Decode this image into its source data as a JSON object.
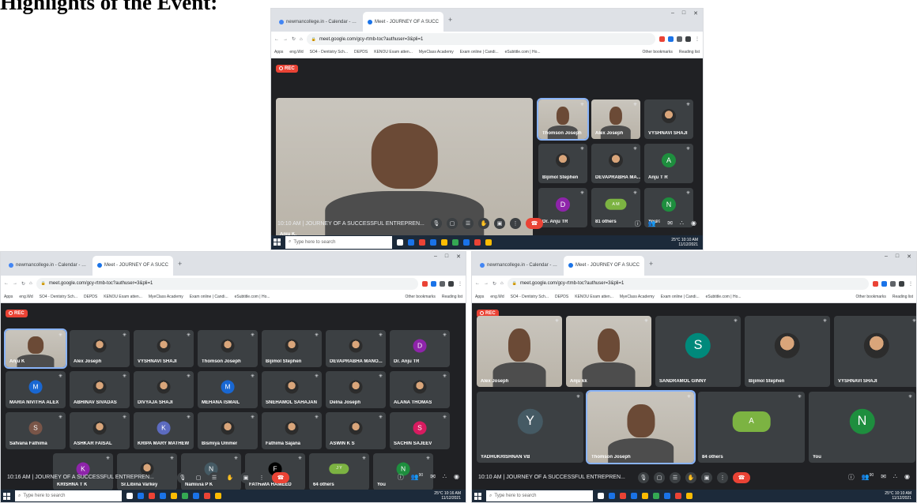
{
  "heading": "Highlights of the Event:",
  "browser": {
    "tabs": [
      "newmancollege.in - Calendar - …",
      "Meet - JOURNEY OF A SUCC"
    ],
    "new_tab": "+",
    "url": "meet.google.com/gcy-rtmb-toc?authuser=3&pli=1",
    "bookmarks": [
      "Apps",
      "eng.Wd",
      "SO4 - Dentistry Sch...",
      "DEPDS",
      "KENOU Exam atten...",
      "MyeClass Academy",
      "Exam online | Candi...",
      "eSubtitle.com | Ho..."
    ],
    "bookmarks_right": [
      "Other bookmarks",
      "Reading list"
    ]
  },
  "meeting": {
    "rec": "REC",
    "title": "JOURNEY OF A SUCCESSFUL ENTREPREN...",
    "end_call_icon": "phone-hangup-icon"
  },
  "taskbar": {
    "search_placeholder": "Type here to search",
    "date": "11/12/2021",
    "weather": "25°C"
  },
  "screens": {
    "top": {
      "time": "10:10 AM",
      "clock": "10:10 AM",
      "main_speaker": "Anju K.",
      "tiles": [
        {
          "name": "Thomson Joseph",
          "type": "video",
          "pinned": true
        },
        {
          "name": "Alex Joseph",
          "type": "video"
        },
        {
          "name": "VYSHNAVI SHAJI",
          "type": "photo"
        },
        {
          "name": "Bijimol Stephen",
          "type": "photo"
        },
        {
          "name": "DEVAPRABHA MA...",
          "type": "photo"
        },
        {
          "name": "Anju T R",
          "type": "letter",
          "letter": "A",
          "color": "#1e8e3e"
        },
        {
          "name": "Dr. Anju TR",
          "type": "letter",
          "letter": "D",
          "color": "#8e24aa"
        },
        {
          "name": "81 others",
          "type": "others",
          "letters": "A M"
        },
        {
          "name": "You",
          "type": "letter",
          "letter": "N",
          "color": "#1e8e3e"
        }
      ],
      "participant_count": "96"
    },
    "left": {
      "time": "10:16 AM",
      "clock": "10:16 AM",
      "participant_count": "90",
      "tiles": [
        {
          "name": "Anju K",
          "type": "video",
          "pinned": true
        },
        {
          "name": "Alex Joseph",
          "type": "photo"
        },
        {
          "name": "VYSHNAVI SHAJI",
          "type": "photo"
        },
        {
          "name": "Thomson Joseph",
          "type": "photo"
        },
        {
          "name": "Bijimol Stephen",
          "type": "photo"
        },
        {
          "name": "DEVAPRABHA MANO...",
          "type": "photo"
        },
        {
          "name": "Dr. Anju TR",
          "type": "letter",
          "letter": "D",
          "color": "#8e24aa"
        },
        {
          "name": "MARIA NIVITHA ALEX",
          "type": "letter",
          "letter": "M",
          "color": "#1967d2"
        },
        {
          "name": "ABHINAV SIVADAS",
          "type": "photo"
        },
        {
          "name": "DIVYAJA SHAJI",
          "type": "photo"
        },
        {
          "name": "MEHANA ISMAIL",
          "type": "letter",
          "letter": "M",
          "color": "#1967d2"
        },
        {
          "name": "SNEHAMOL SAHAJAN",
          "type": "photo"
        },
        {
          "name": "Delna Joseph",
          "type": "photo"
        },
        {
          "name": "ALANA THOMAS",
          "type": "photo"
        },
        {
          "name": "Safvana Fathima",
          "type": "letter",
          "letter": "S",
          "color": "#795548"
        },
        {
          "name": "ASHKAR FAISAL",
          "type": "photo"
        },
        {
          "name": "KRIPA MARY MATHEW",
          "type": "letter",
          "letter": "K",
          "color": "#5c6bc0"
        },
        {
          "name": "Bismiya Ummer",
          "type": "photo"
        },
        {
          "name": "Fathima Sajana",
          "type": "photo"
        },
        {
          "name": "ASWIN K S",
          "type": "photo"
        },
        {
          "name": "SACHIN SAJEEV",
          "type": "letter",
          "letter": "S",
          "color": "#d81b60"
        },
        {
          "name": "KRISHNA T K",
          "type": "letter",
          "letter": "K",
          "color": "#8e24aa"
        },
        {
          "name": "Sr.Libina Varkey",
          "type": "photo"
        },
        {
          "name": "Namitha P K",
          "type": "letter",
          "letter": "N",
          "color": "#455a64"
        },
        {
          "name": "FATHIMA HAMEED",
          "type": "letter",
          "letter": "F",
          "color": "#000000"
        },
        {
          "name": "64 others",
          "type": "others",
          "letters": "J Y"
        },
        {
          "name": "You",
          "type": "letter",
          "letter": "N",
          "color": "#1e8e3e"
        }
      ]
    },
    "right": {
      "time": "10:10 AM",
      "clock": "10:10 AM",
      "participant_count": "90",
      "tiles": [
        {
          "name": "Alex Joseph",
          "type": "video"
        },
        {
          "name": "Anju kk",
          "type": "video"
        },
        {
          "name": "SANDRAMOL GINNY",
          "type": "letter",
          "letter": "S",
          "color": "#00897b"
        },
        {
          "name": "Bijimol Stephen",
          "type": "photo"
        },
        {
          "name": "VYSHNAVI SHAJI",
          "type": "photo"
        },
        {
          "name": "YADHUKRISHNAN VB",
          "type": "letter",
          "letter": "Y",
          "color": "#455a64"
        },
        {
          "name": "Thomson Joseph",
          "type": "video",
          "pinned": true
        },
        {
          "name": "84 others",
          "type": "others",
          "letters": "A"
        },
        {
          "name": "You",
          "type": "letter",
          "letter": "N",
          "color": "#1e8e3e"
        }
      ]
    }
  },
  "colors": {
    "meet_bg": "#202124",
    "tile_bg": "#3c4043",
    "rec": "#ea4335",
    "accent": "#8ab4f8"
  }
}
